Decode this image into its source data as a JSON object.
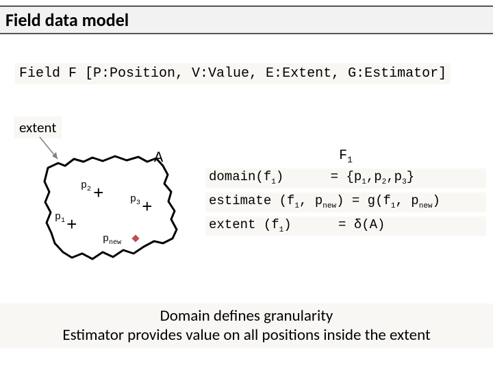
{
  "title": "Field data model",
  "definition": "Field F [P:Position, V:Value, E:Extent, G:Estimator]",
  "extent_label": "extent",
  "diagram": {
    "region_label": "A",
    "points": [
      {
        "name": "p",
        "sub": "1"
      },
      {
        "name": "p",
        "sub": "2"
      },
      {
        "name": "p",
        "sub": "3"
      },
      {
        "name": "p",
        "sub": "new"
      }
    ]
  },
  "example": {
    "heading_base": "F",
    "heading_sub": "1",
    "lines": [
      "domain(f1)       = {p1,p2,p3}",
      "estimate (f1, pnew) = g(f1, pnew)",
      "extent (f1)      = δ(A)"
    ]
  },
  "summary": {
    "line1": "Domain defines granularity",
    "line2": "Estimator provides value on all positions inside the extent"
  }
}
